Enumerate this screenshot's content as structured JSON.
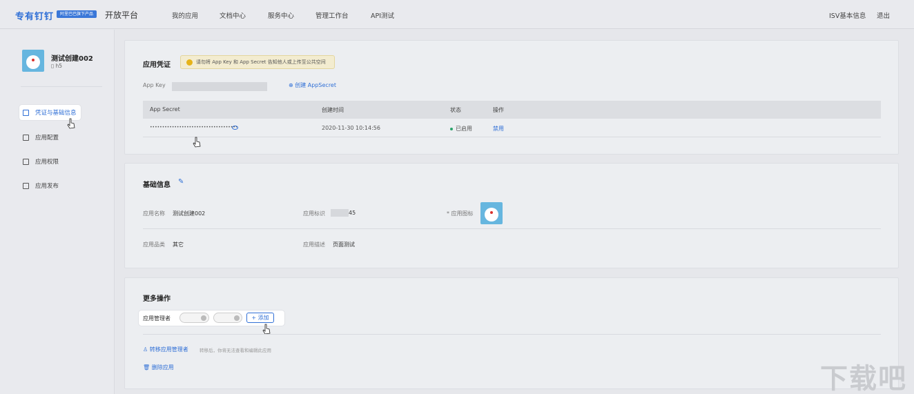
{
  "header": {
    "brand": "专有钉钉",
    "brand_tag": "阿里巴巴旗下产品",
    "platform": "开放平台",
    "nav": [
      "我的应用",
      "文档中心",
      "服务中心",
      "管理工作台",
      "API测试"
    ],
    "isv": "ISV基本信息",
    "logout": "退出"
  },
  "sidebar": {
    "app_name": "测试创建002",
    "app_type": "h5",
    "items": [
      {
        "label": "凭证与基础信息",
        "icon": "document-icon",
        "active": true
      },
      {
        "label": "应用配置",
        "icon": "config-icon"
      },
      {
        "label": "应用权限",
        "icon": "lock-icon"
      },
      {
        "label": "应用发布",
        "icon": "publish-icon"
      }
    ]
  },
  "credentials": {
    "title": "应用凭证",
    "warning": "请勿将 App Key 和 App Secret 告知他人或上传至公共空间",
    "app_key_label": "App Key",
    "create_secret": "创建 AppSecret",
    "table": {
      "headers": [
        "App Secret",
        "创建时间",
        "状态",
        "操作"
      ],
      "rows": [
        {
          "secret": "••••••••••••••••••••••••••••••••••••",
          "created": "2020-11-30 10:14:56",
          "status": "已启用",
          "action": "禁用"
        }
      ]
    }
  },
  "basic": {
    "title": "基础信息",
    "name_label": "应用名称",
    "name_value": "测试创建002",
    "id_label": "应用标识",
    "id_value": "45",
    "icon_label": "* 应用图标",
    "category_label": "应用品类",
    "category_value": "其它",
    "desc_label": "应用描述",
    "desc_value": "页面测试"
  },
  "more": {
    "title": "更多操作",
    "manager_label": "应用管理者",
    "add_label": "+ 添加",
    "transfer_label": "转移应用管理者",
    "transfer_hint": "转移后，你将无法查看和编辑此应用",
    "delete_label": "删除应用"
  },
  "watermark": "下载吧"
}
